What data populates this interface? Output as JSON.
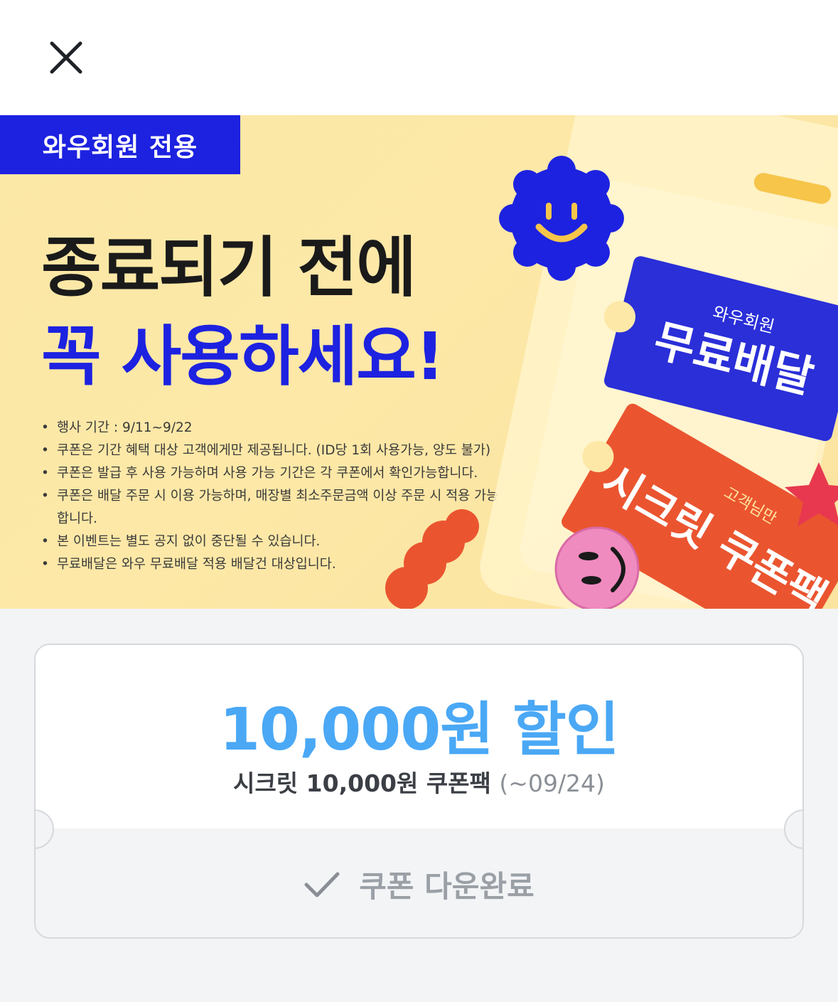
{
  "header": {
    "close_icon": "close-icon"
  },
  "banner": {
    "tag": "와우회원 전용",
    "headline_line1": "종료되기 전에",
    "headline_line2": "꼭 사용하세요!",
    "notes": [
      "행사 기간 : 9/11~9/22",
      "쿠폰은 기간 혜택 대상 고객에게만 제공됩니다. (ID당 1회 사용가능, 양도 불가)",
      "쿠폰은 발급 후 사용 가능하며 사용 가능 기간은 각 쿠폰에서 확인가능합니다.",
      "쿠폰은 배달 주문 시 이용 가능하며, 매장별 최소주문금액 이상 주문 시 적용 가능합니다.",
      "본 이벤트는 별도 공지 없이 중단될 수 있습니다.",
      "무료배달은 와우 무료배달 적용 배달건 대상입니다."
    ],
    "ticket_blue_small": "와우회원",
    "ticket_blue_big": "무료배달",
    "ticket_red_small": "고객님만",
    "ticket_red_big": "시크릿 쿠폰팩",
    "colors": {
      "brand_blue": "#1d22e0",
      "background": "#fde8a7",
      "orange": "#ea5530",
      "pink": "#f08bc0"
    }
  },
  "coupon": {
    "discount": "10,000원 할인",
    "name": "시크릿 10,000원 쿠폰팩",
    "period": "(~09/24)",
    "status_label": "쿠폰 다운완료",
    "status_icon": "checkmark-icon",
    "accent_color": "#4aa8f5"
  }
}
